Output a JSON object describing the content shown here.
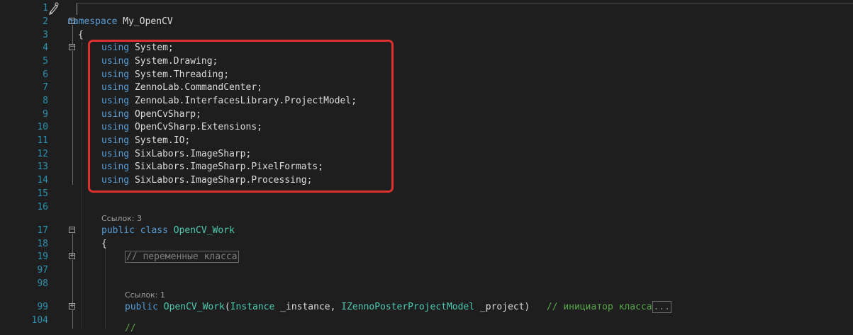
{
  "line_numbers": [
    "1",
    "2",
    "3",
    "4",
    "5",
    "6",
    "7",
    "8",
    "9",
    "10",
    "11",
    "12",
    "13",
    "14",
    "15",
    "16",
    "17",
    "18",
    "19",
    "97",
    "98",
    "99",
    "104"
  ],
  "code": {
    "l2_kw": "namespace",
    "l2_name": " My_OpenCV",
    "l3": "{",
    "usings": [
      [
        "using",
        " System;"
      ],
      [
        "using",
        " System.Drawing;"
      ],
      [
        "using",
        " System.Threading;"
      ],
      [
        "using",
        " ZennoLab.CommandCenter;"
      ],
      [
        "using",
        " ZennoLab.InterfacesLibrary.ProjectModel;"
      ],
      [
        "using",
        " OpenCvSharp;"
      ],
      [
        "using",
        " OpenCvSharp.Extensions;"
      ],
      [
        "using",
        " System.IO;"
      ],
      [
        "using",
        " SixLabors.ImageSharp;"
      ],
      [
        "using",
        " SixLabors.ImageSharp.PixelFormats;"
      ],
      [
        "using",
        " SixLabors.ImageSharp.Processing;"
      ]
    ],
    "ref_class": "Ссылок: 3",
    "l17_kw": "public class",
    "l17_name": "OpenCV_Work",
    "l18": "{",
    "l19_region": "// переменные класса",
    "ref_ctor": "Ссылок: 1",
    "l99_kw": "public",
    "l99_name": "OpenCV_Work",
    "l99_open": "(",
    "l99_type1": "Instance",
    "l99_arg1": " _instance, ",
    "l99_type2": "IZennoPosterProjectModel",
    "l99_arg2": " _project)",
    "l99_comment": "// инициатор класса",
    "l99_collapsed": "...",
    "l104": "//"
  },
  "colors": {
    "background": "#1e1e1e",
    "line_number": "#2b91af",
    "keyword": "#569cd6",
    "type": "#4ec9b0",
    "comment": "#57a64a",
    "highlight_border": "#e0302e"
  },
  "icons": {
    "breakpoint": "pencil-icon"
  }
}
